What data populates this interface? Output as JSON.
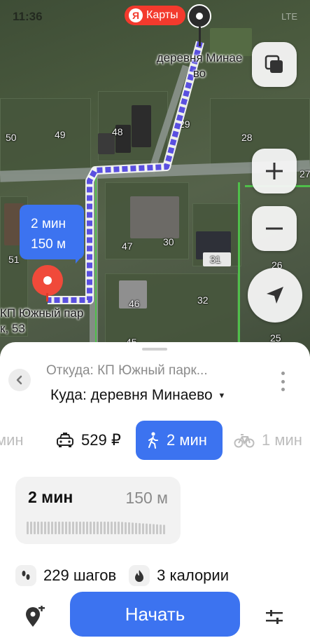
{
  "status_bar": {
    "time": "11:36",
    "network": "LTE"
  },
  "map": {
    "brand_label": "Карты",
    "brand_logo_letter": "Я",
    "destination_label_line1": "деревня Минае",
    "destination_label_line2": "во",
    "origin_label_line1": "КП Южный пар",
    "origin_label_line2": "к, 53",
    "route_bubble": {
      "time": "2 мин",
      "distance": "150 м"
    },
    "house_numbers": [
      "50",
      "49",
      "48",
      "29",
      "28",
      "27",
      "51",
      "47",
      "30",
      "31",
      "26",
      "46",
      "32",
      "25",
      "45"
    ],
    "controls": [
      "layers-icon",
      "zoom-in-icon",
      "zoom-out-icon",
      "locate-icon"
    ]
  },
  "route_panel": {
    "from": "Откуда: КП Южный парк...",
    "to": "Куда: деревня Минаево",
    "to_dropdown_icon": "▾",
    "modes": {
      "prev": "мин",
      "taxi": "529 ₽",
      "walk": "2 мин",
      "bike": "1 мин"
    },
    "selected_mode": "walk",
    "route_card": {
      "time": "2 мин",
      "distance": "150 м"
    },
    "stats": {
      "steps": "229 шагов",
      "calories": "3 калории"
    },
    "start_label": "Начать"
  },
  "colors": {
    "accent": "#3c73f0",
    "brand_red": "#f33a2d",
    "pin_red": "#f04a3a"
  }
}
